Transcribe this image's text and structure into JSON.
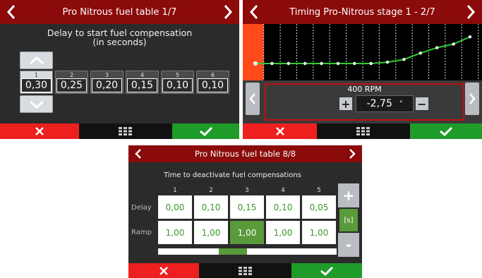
{
  "panel1": {
    "title": "Pro Nitrous fuel table 1/7",
    "description_line1": "Delay to start fuel compensation",
    "description_line2": "(in seconds)",
    "cells": [
      {
        "index": "1",
        "value": "0,30",
        "selected": true
      },
      {
        "index": "2",
        "value": "0,25"
      },
      {
        "index": "3",
        "value": "0,20"
      },
      {
        "index": "4",
        "value": "0,15"
      },
      {
        "index": "5",
        "value": "0,10"
      },
      {
        "index": "6",
        "value": "0,10"
      }
    ]
  },
  "panel2": {
    "title": "Timing Pro-Nitrous stage 1 - 2/7",
    "rpm_label": "400 RPM",
    "value": "-2,75",
    "unit": "°",
    "plus_label": "+",
    "minus_label": "−",
    "curve_points": [
      -2.75,
      -2.75,
      -2.75,
      -2.75,
      -2.75,
      -2.75,
      -2.75,
      -2.75,
      -2.6,
      -2.3,
      -1.6,
      -1.0,
      -0.6,
      0.2
    ],
    "colors": {
      "highlight": "#ff4a1a",
      "curve": "#2ecc2e",
      "grid": "#dddddd"
    }
  },
  "panel3": {
    "title": "Pro Nitrous fuel table 8/8",
    "description": "Time to deactivate fuel compensations",
    "columns": [
      "1",
      "2",
      "3",
      "4",
      "5"
    ],
    "rows": [
      {
        "label": "Delay",
        "values": [
          "0,00",
          "0,10",
          "0,15",
          "0,10",
          "0,05"
        ]
      },
      {
        "label": "Ramp",
        "values": [
          "1,00",
          "1,00",
          "1,00",
          "1,00",
          "1,00"
        ]
      }
    ],
    "selected_cell": {
      "row": 1,
      "col": 2
    },
    "unit": "[s]",
    "plus_label": "+",
    "minus_label": "-"
  },
  "colors": {
    "title_bar": "#8b0a0a",
    "cancel": "#ee1f1f",
    "confirm": "#1f9b2a",
    "selection_green": "#5a9a3a"
  },
  "icons": [
    "chevron-left-icon",
    "chevron-right-icon",
    "close-icon",
    "grid-menu-icon",
    "checkmark-icon",
    "chevron-up-icon",
    "chevron-down-icon"
  ]
}
